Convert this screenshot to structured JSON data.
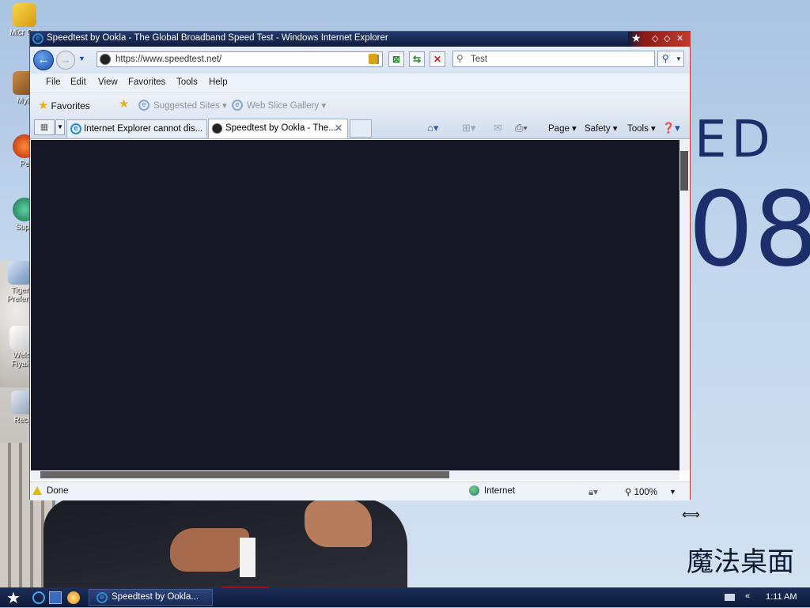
{
  "window": {
    "title": "Speedtest by Ookla - The Global Broadband Speed Test - Windows Internet Explorer"
  },
  "address_bar": {
    "url": "https://www.speedtest.net/"
  },
  "search": {
    "text": "Test"
  },
  "menu": [
    "File",
    "Edit",
    "View",
    "Favorites",
    "Tools",
    "Help"
  ],
  "favorites_bar": {
    "favorites_label": "Favorites",
    "items": [
      "Suggested Sites",
      "Web Slice Gallery"
    ]
  },
  "tabs": [
    {
      "label": "Internet Explorer cannot dis...",
      "active": false
    },
    {
      "label": "Speedtest by Ookla - The...",
      "active": true
    }
  ],
  "command_bar": {
    "page": "Page",
    "safety": "Safety",
    "tools": "Tools"
  },
  "status_bar": {
    "status": "Done",
    "zone": "Internet",
    "zoom": "100%"
  },
  "desktop": {
    "icons": [
      "Micr Out",
      "MyP",
      "Pe",
      "Supe",
      "Tiger Prefere",
      "Welc Flyaki",
      "Recy"
    ],
    "wallpaper_text_top": "ED",
    "wallpaper_text_big": "08",
    "wallpaper_logo": "魔法桌面"
  },
  "taskbar": {
    "button_label": "Speedtest by Ookla...",
    "clock": "1:11 AM"
  },
  "colors": {
    "content_bg": "#161726",
    "titlebar": "#0e1b3d",
    "taskbar": "#0e1a38"
  }
}
